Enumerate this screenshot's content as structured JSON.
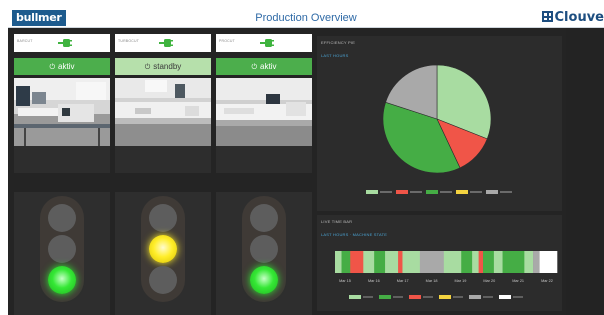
{
  "header": {
    "brand_left": "bullmer",
    "title": "Production Overview",
    "brand_right": "Clouve"
  },
  "stations": [
    {
      "power_label": "BARCUT",
      "status": "aktiv",
      "status_color": "#4cae4c",
      "light": "green"
    },
    {
      "power_label": "TURBOCUT",
      "status": "standby",
      "status_color": "#b6e0ab",
      "light": "yellow"
    },
    {
      "power_label": "PROCUT",
      "status": "aktiv",
      "status_color": "#4cae4c",
      "light": "green"
    }
  ],
  "colors": {
    "plug": "#3fb33f",
    "lamp_green": "#35e835",
    "lamp_yellow": "#ffee2a",
    "lamp_off": "#5d5d5d"
  },
  "icons": {
    "plug": "plug-icon",
    "status": "power-icon",
    "brand": "cross-square-icon"
  },
  "pie_panel": {
    "title": "EFFICIENCY PIE",
    "subtitle": "LAST HOURS"
  },
  "gantt_panel": {
    "title": "LIVE TIME BAR",
    "subtitle": "LAST HOURS · MACHINE STATE",
    "ticks": [
      "Mar 15",
      "Mar 16",
      "Mar 17",
      "Mar 18",
      "Mar 19",
      "Mar 20",
      "Mar 21",
      "Mar 22"
    ]
  },
  "chart_data": [
    {
      "type": "pie",
      "title": "",
      "series": [
        {
          "name": "",
          "value": 31,
          "color": "#a8dca1"
        },
        {
          "name": "",
          "value": 12,
          "color": "#f05548"
        },
        {
          "name": "",
          "value": 37,
          "color": "#45ad45"
        },
        {
          "name": "",
          "value": 0,
          "color": "#f4d340"
        },
        {
          "name": "",
          "value": 20,
          "color": "#a9a9a9"
        }
      ],
      "legend_position": "bottom"
    },
    {
      "type": "bar",
      "title": "",
      "segments": [
        {
          "color": "#a8dca1",
          "weight": 3
        },
        {
          "color": "#45ad45",
          "weight": 4
        },
        {
          "color": "#f05548",
          "weight": 6
        },
        {
          "color": "#a8dca1",
          "weight": 5
        },
        {
          "color": "#45ad45",
          "weight": 5
        },
        {
          "color": "#a8dca1",
          "weight": 6
        },
        {
          "color": "#f05548",
          "weight": 2
        },
        {
          "color": "#a8dca1",
          "weight": 8
        },
        {
          "color": "#a9a9a9",
          "weight": 11
        },
        {
          "color": "#a8dca1",
          "weight": 8
        },
        {
          "color": "#45ad45",
          "weight": 5
        },
        {
          "color": "#a8dca1",
          "weight": 3
        },
        {
          "color": "#f05548",
          "weight": 2
        },
        {
          "color": "#45ad45",
          "weight": 5
        },
        {
          "color": "#a8dca1",
          "weight": 4
        },
        {
          "color": "#45ad45",
          "weight": 10
        },
        {
          "color": "#a8dca1",
          "weight": 4
        },
        {
          "color": "#a9a9a9",
          "weight": 3
        },
        {
          "color": "#ffffff",
          "weight": 8
        }
      ],
      "legend_colors": [
        "#a8dca1",
        "#45ad45",
        "#f05548",
        "#f4d340",
        "#a9a9a9",
        "#ffffff"
      ]
    }
  ]
}
